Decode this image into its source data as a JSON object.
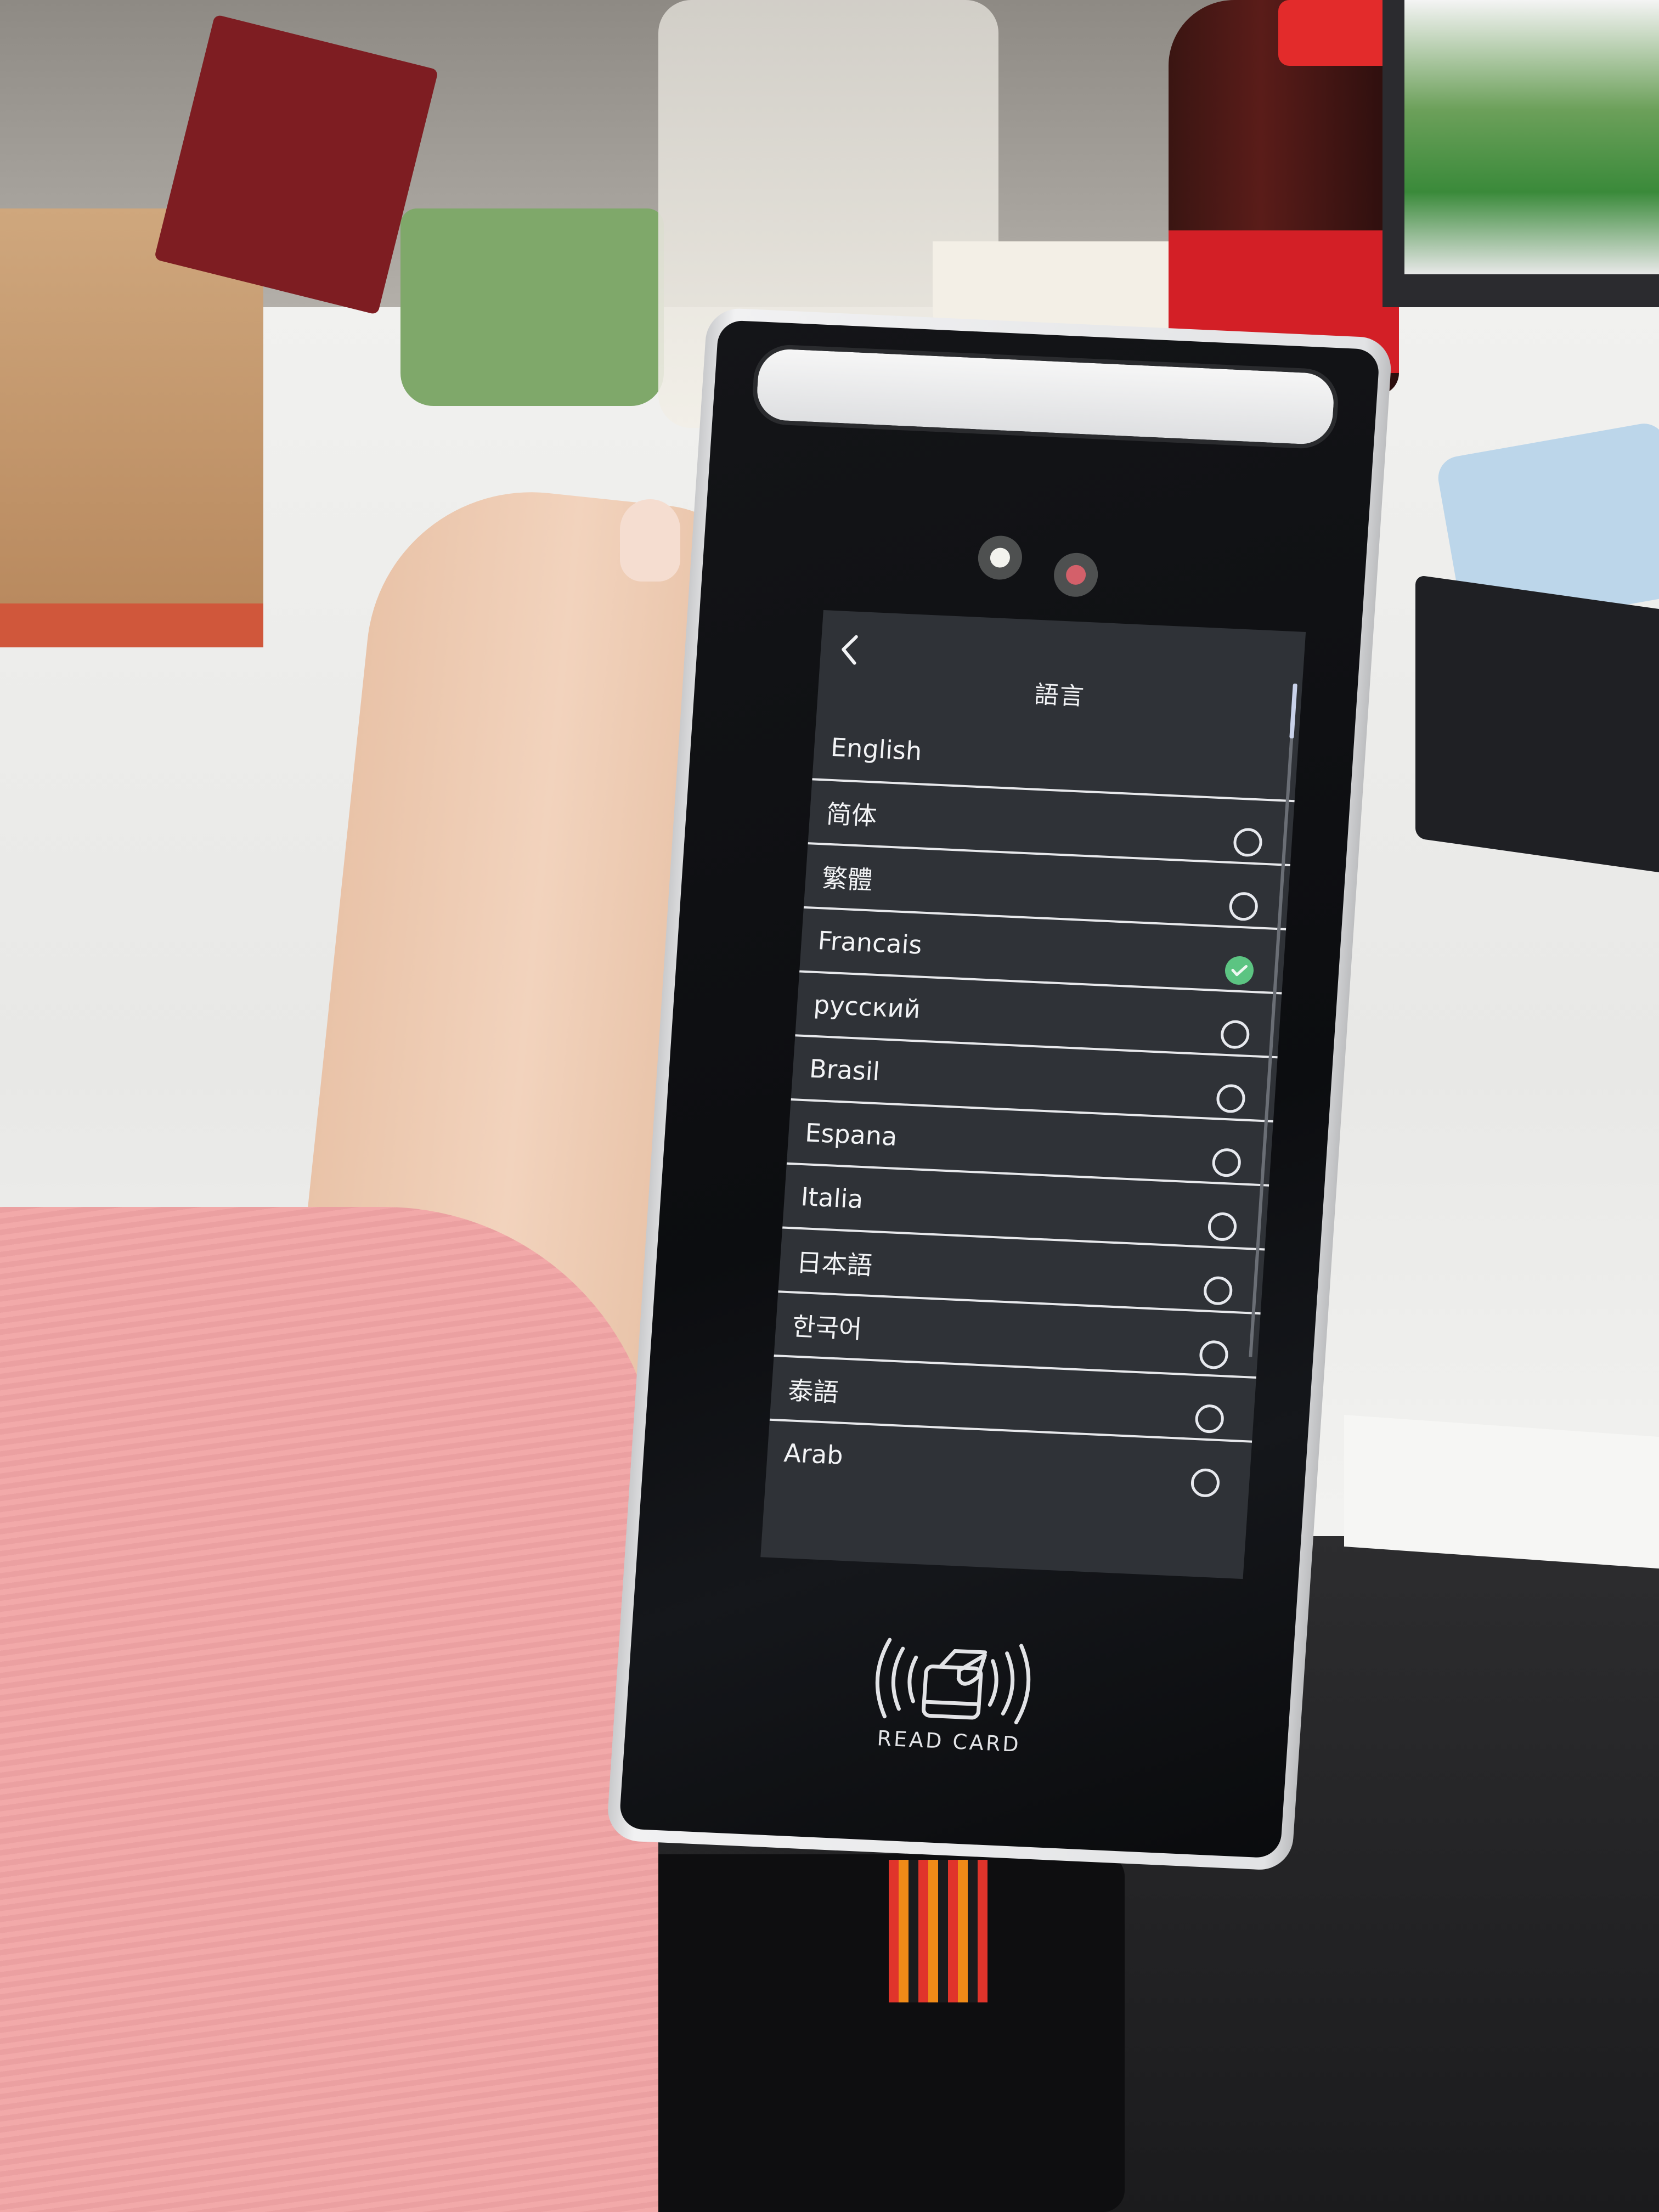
{
  "screen": {
    "title": "語言",
    "back_icon": "chevron-left-icon",
    "languages": [
      {
        "label": "English",
        "state": "none"
      },
      {
        "label": "简体",
        "state": "unselected"
      },
      {
        "label": "繁體",
        "state": "unselected"
      },
      {
        "label": "Francais",
        "state": "selected"
      },
      {
        "label": "русский",
        "state": "unselected"
      },
      {
        "label": "Brasil",
        "state": "unselected"
      },
      {
        "label": "Espana",
        "state": "unselected"
      },
      {
        "label": "Italia",
        "state": "unselected"
      },
      {
        "label": "日本語",
        "state": "unselected"
      },
      {
        "label": "한국어",
        "state": "unselected"
      },
      {
        "label": "泰語",
        "state": "unselected"
      },
      {
        "label": "Arab",
        "state": "unselected"
      }
    ],
    "selected_language": "Francais",
    "colors": {
      "background": "#2f3237",
      "text": "#f2f3f5",
      "divider": "#e8e9ec",
      "selected_check": "#5cc482",
      "radio_outline": "#e7e9ee"
    }
  },
  "device": {
    "card_reader_label": "READ CARD",
    "card_reader_icon": "nfc-card-icon"
  }
}
